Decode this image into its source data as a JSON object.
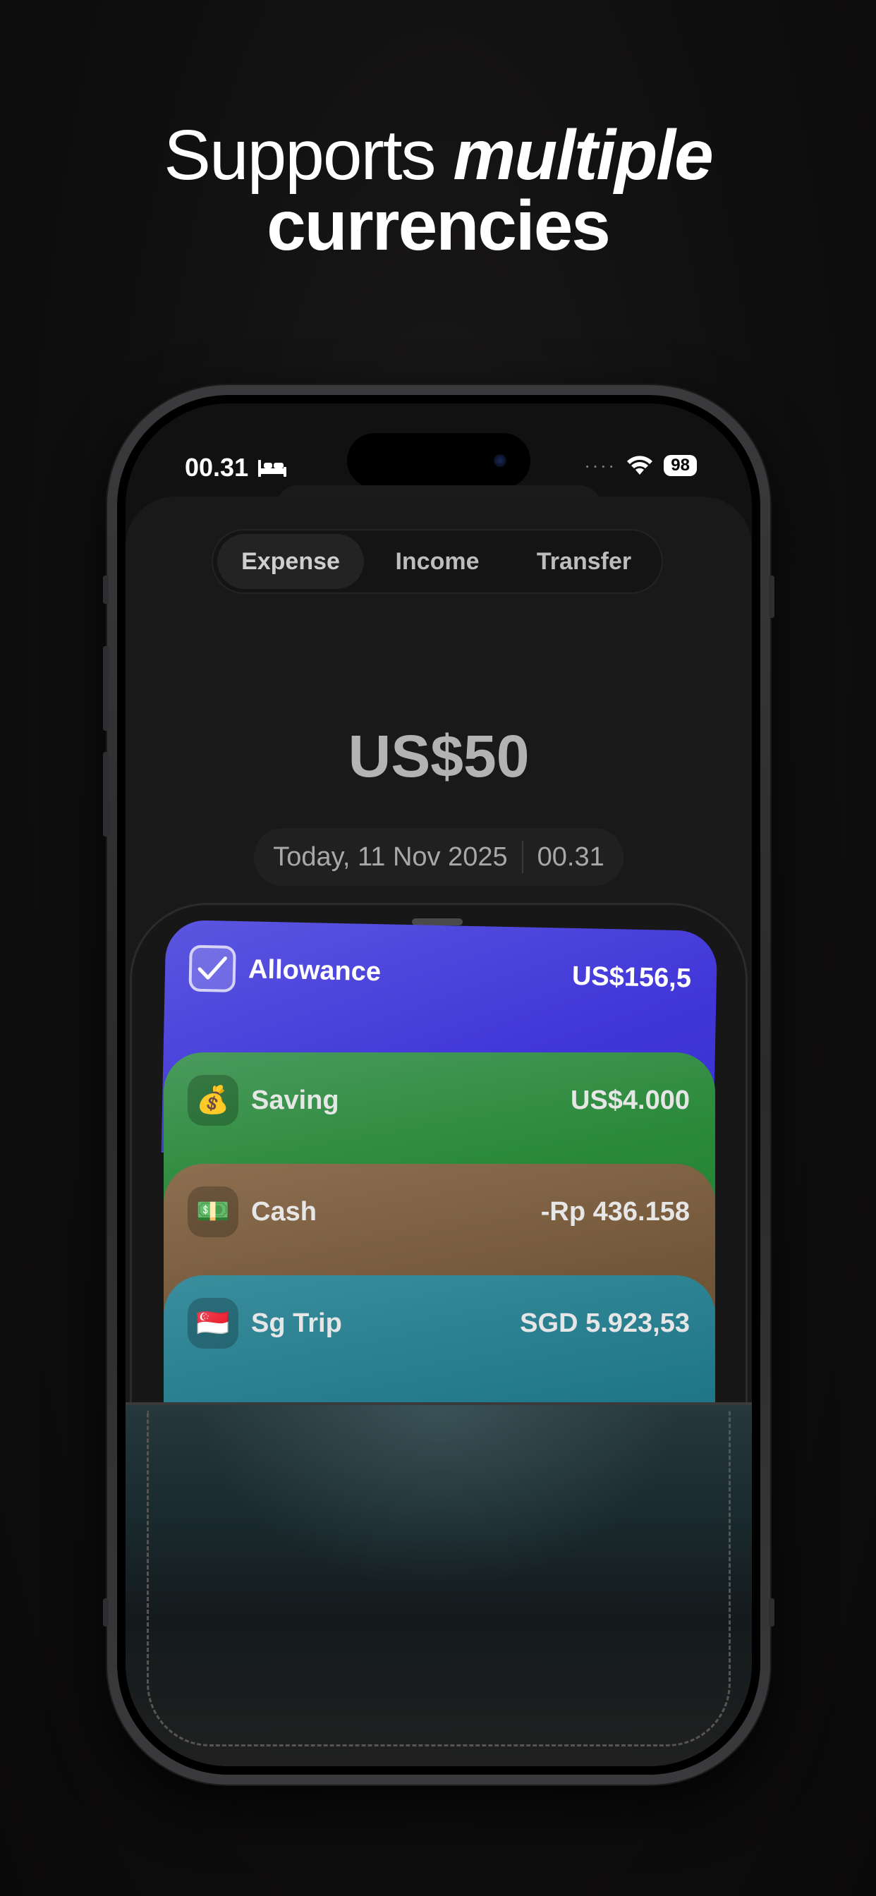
{
  "headline": {
    "line1_plain": "Supports ",
    "line1_emphasis": "multiple",
    "line2": "currencies"
  },
  "status_bar": {
    "time": "00.31",
    "sleep_icon": "bed-icon",
    "signal": "····",
    "wifi_icon": "wifi-icon",
    "battery": "98"
  },
  "segments": [
    {
      "label": "Expense",
      "active": true
    },
    {
      "label": "Income",
      "active": false
    },
    {
      "label": "Transfer",
      "active": false
    }
  ],
  "amount": "US$50",
  "date": {
    "day": "Today, 11 Nov 2025",
    "time": "00.31"
  },
  "accounts": [
    {
      "name": "Allowance",
      "balance": "US$156,5",
      "icon": "checkbox-icon",
      "color": "#4136d8"
    },
    {
      "name": "Saving",
      "balance": "US$4.000",
      "icon": "💰",
      "color": "#2a8a3a"
    },
    {
      "name": "Cash",
      "balance": "-Rp 436.158",
      "icon": "💵",
      "color": "#725638"
    },
    {
      "name": "Sg Trip",
      "balance": "SGD 5.923,53",
      "icon": "🇸🇬",
      "color": "#217889"
    }
  ]
}
